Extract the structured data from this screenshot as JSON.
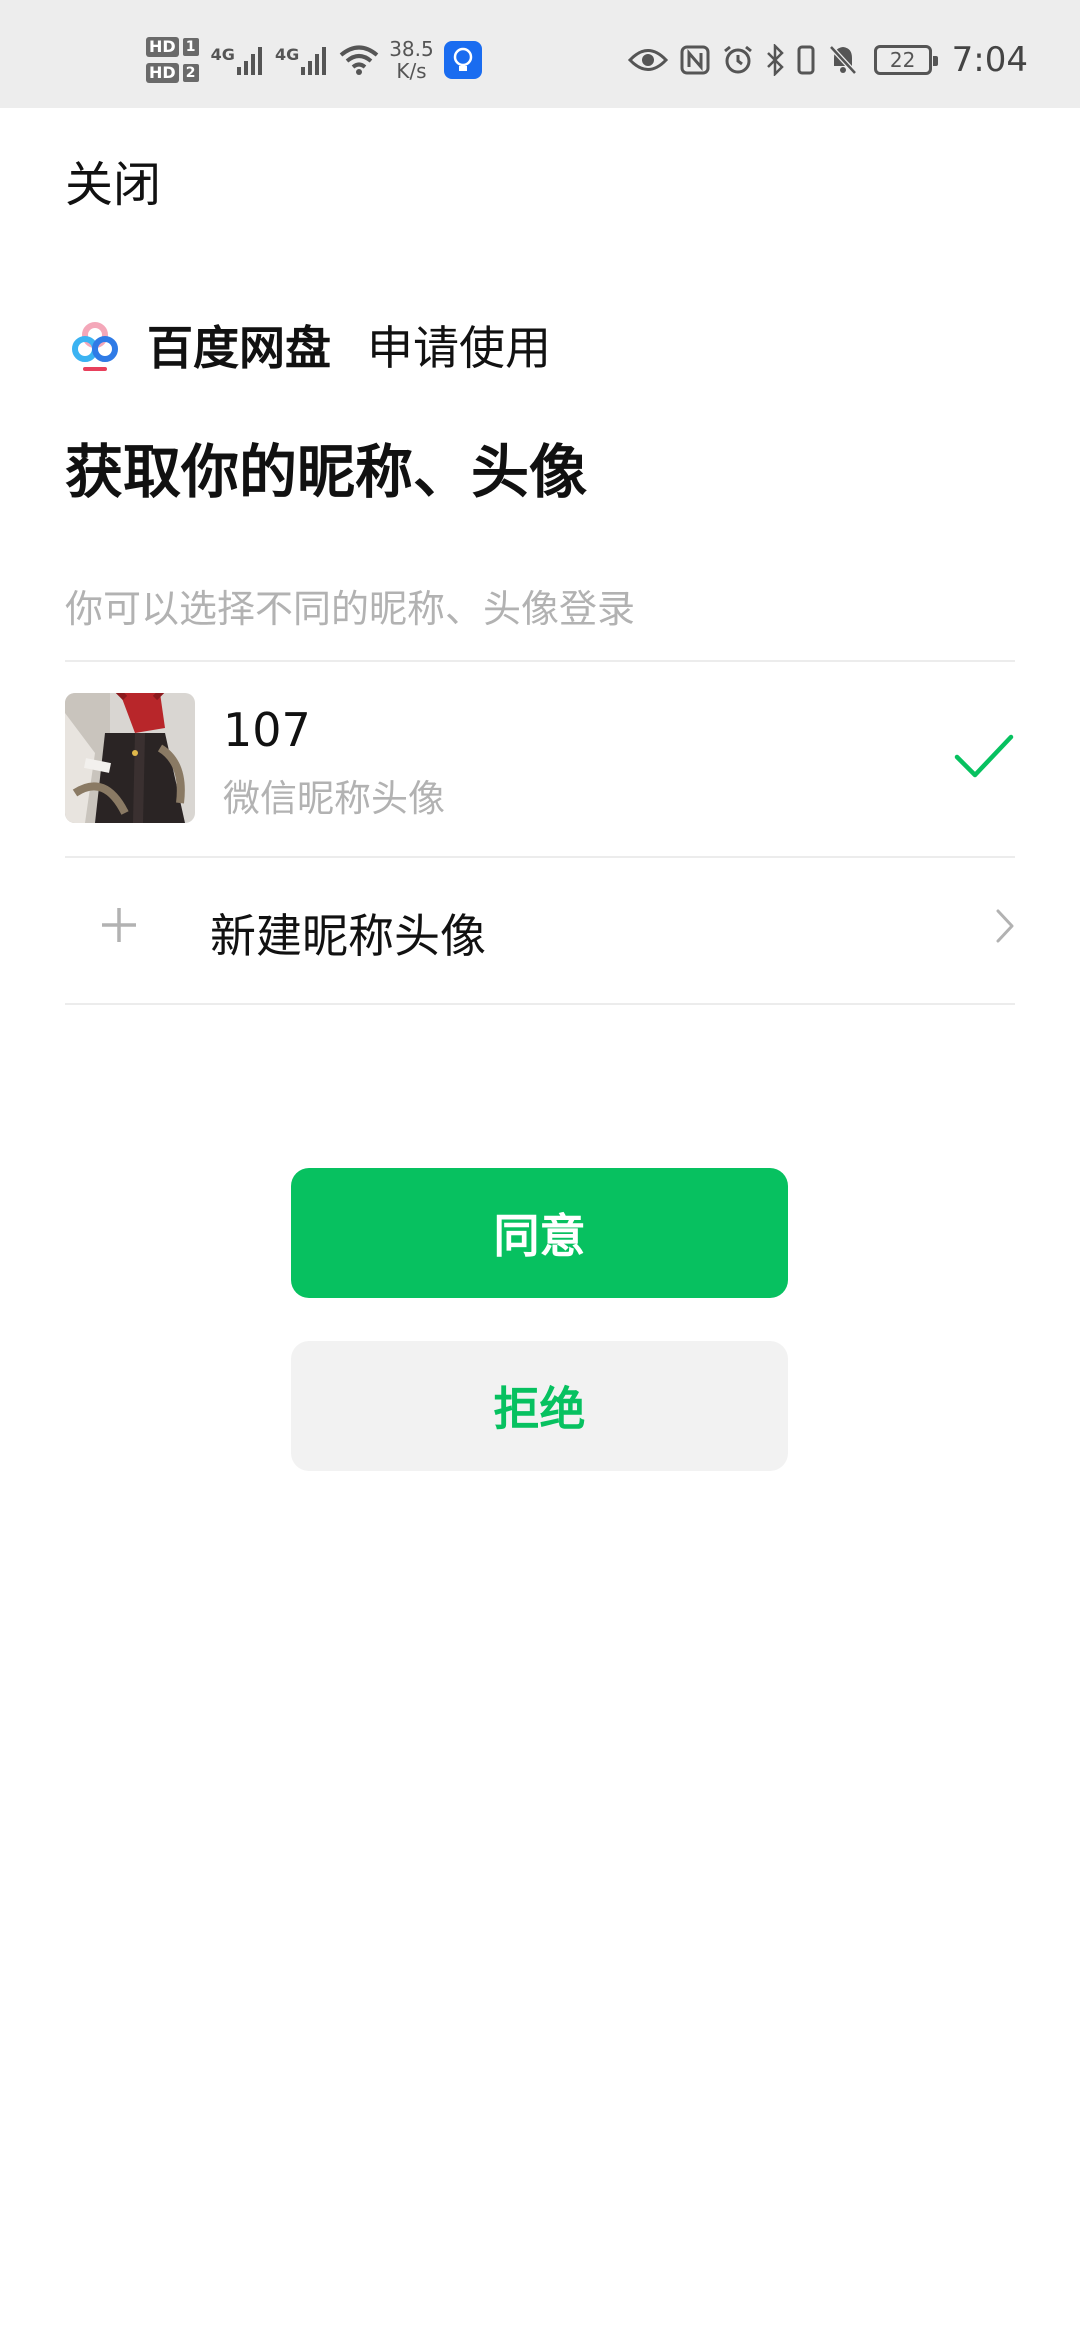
{
  "status_bar": {
    "hd1": "HD",
    "sim1": "1",
    "hd2": "HD",
    "sim2": "2",
    "net1": "4G",
    "net2": "4G",
    "speed_value": "38.5",
    "speed_unit": "K/s",
    "battery": "22",
    "time": "7:04"
  },
  "header": {
    "close_label": "关闭"
  },
  "app": {
    "name": "百度网盘",
    "apply_text": "申请使用"
  },
  "main": {
    "heading": "获取你的昵称、头像",
    "hint": "你可以选择不同的昵称、头像登录",
    "profile": {
      "nickname": "107",
      "subtitle": "微信昵称头像"
    },
    "new_profile_label": "新建昵称头像"
  },
  "actions": {
    "agree_label": "同意",
    "reject_label": "拒绝"
  },
  "colors": {
    "accent": "#07c160",
    "secondary_button_bg": "#f2f2f2",
    "hint_text": "#b2b2b2"
  }
}
